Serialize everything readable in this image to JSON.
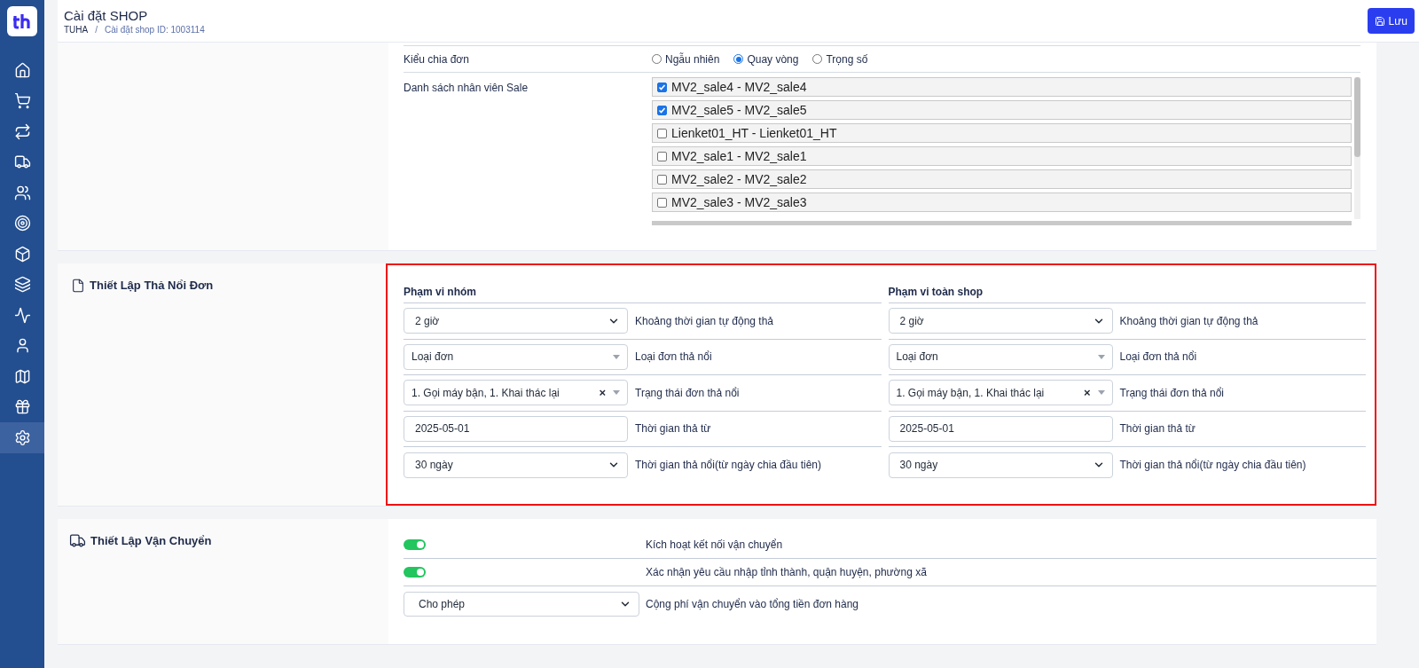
{
  "sidebar": {
    "items": [
      {
        "kind": "home",
        "selected": false
      },
      {
        "kind": "cart",
        "selected": false
      },
      {
        "kind": "repeat",
        "selected": false
      },
      {
        "kind": "truck",
        "selected": false
      },
      {
        "kind": "users",
        "selected": false
      },
      {
        "kind": "target",
        "selected": false
      },
      {
        "kind": "box",
        "selected": false
      },
      {
        "kind": "layers",
        "selected": false
      },
      {
        "kind": "activity",
        "selected": false
      },
      {
        "kind": "user",
        "selected": false
      },
      {
        "kind": "map",
        "selected": false
      },
      {
        "kind": "gift",
        "selected": false
      },
      {
        "kind": "settings",
        "selected": true
      }
    ]
  },
  "header": {
    "title": "Cài đặt SHOP",
    "breadcrumb": [
      "TUHA",
      "Cài đặt shop ID: 1003114"
    ],
    "separator": "/",
    "save_button": "Lưu"
  },
  "distribution": {
    "split_type": {
      "label": "Kiểu chia đơn",
      "options": [
        {
          "label": "Ngẫu nhiên",
          "selected": false
        },
        {
          "label": "Quay vòng",
          "selected": true
        },
        {
          "label": "Trọng số",
          "selected": false
        }
      ]
    },
    "sales": {
      "label": "Danh sách nhân viên Sale",
      "items": [
        {
          "label": "MV2_sale4 - MV2_sale4",
          "checked": true
        },
        {
          "label": "MV2_sale5 - MV2_sale5",
          "checked": true
        },
        {
          "label": "Lienket01_HT - Lienket01_HT",
          "checked": false
        },
        {
          "label": "MV2_sale1 - MV2_sale1",
          "checked": false
        },
        {
          "label": "MV2_sale2 - MV2_sale2",
          "checked": false
        },
        {
          "label": "MV2_sale3 - MV2_sale3",
          "checked": false
        }
      ]
    }
  },
  "float_section": {
    "title": "Thiết Lập Thả Nổi Đơn",
    "highlighted": true,
    "columns": [
      {
        "heading": "Phạm vi nhóm",
        "rows": [
          {
            "kind": "select",
            "value": "2 giờ",
            "label": "Khoảng thời gian tự động thả"
          },
          {
            "kind": "combo",
            "value": "Loại đơn",
            "label": "Loại đơn thả nổi"
          },
          {
            "kind": "multi",
            "value": "1. Gọi máy bận, 1. Khai thác lại",
            "clear": "×",
            "label": "Trạng thái đơn thả nổi"
          },
          {
            "kind": "date",
            "value": "2025-05-01",
            "label": "Thời gian thả từ"
          },
          {
            "kind": "select",
            "value": "30 ngày",
            "label": "Thời gian thả nổi(từ ngày chia đầu tiên)"
          }
        ]
      },
      {
        "heading": "Phạm vi toàn shop",
        "rows": [
          {
            "kind": "select",
            "value": "2 giờ",
            "label": "Khoảng thời gian tự động thả"
          },
          {
            "kind": "combo",
            "value": "Loại đơn",
            "label": "Loại đơn thả nổi"
          },
          {
            "kind": "multi",
            "value": "1. Gọi máy bận, 1. Khai thác lại",
            "clear": "×",
            "label": "Trạng thái đơn thả nổi"
          },
          {
            "kind": "date",
            "value": "2025-05-01",
            "label": "Thời gian thả từ"
          },
          {
            "kind": "select",
            "value": "30 ngày",
            "label": "Thời gian thả nổi(từ ngày chia đầu tiên)"
          }
        ]
      }
    ]
  },
  "shipping_section": {
    "title": "Thiết Lập Vận Chuyển",
    "rows": [
      {
        "kind": "toggle",
        "on": true,
        "label": "Kích hoạt kết nối vận chuyển"
      },
      {
        "kind": "toggle",
        "on": true,
        "label": "Xác nhận yêu cầu nhập tỉnh thành, quận huyện, phường xã"
      },
      {
        "kind": "select",
        "value": "Cho phép",
        "label": "Cộng phí vận chuyển vào tổng tiền đơn hàng"
      }
    ]
  }
}
